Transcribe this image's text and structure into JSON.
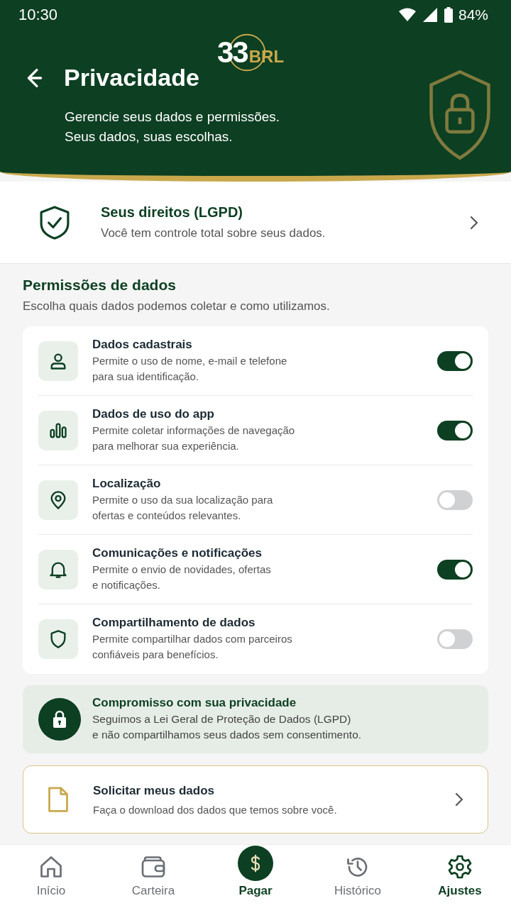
{
  "status_bar": {
    "time": "10:30",
    "battery": "84%"
  },
  "header": {
    "logo_number": "33",
    "logo_currency": "BRL",
    "title": "Privacidade",
    "subtitle": "Gerencie seus dados e permissões.\nSeus dados, suas escolhas."
  },
  "rights": {
    "title": "Seus direitos (LGPD)",
    "subtitle": "Você tem controle total sobre seus dados."
  },
  "permissions_section": {
    "title": "Permissões de dados",
    "subtitle": "Escolha quais dados podemos coletar e como utilizamos."
  },
  "permissions": [
    {
      "title": "Dados cadastrais",
      "description": "Permite o uso de nome, e-mail e telefone\npara sua identificação.",
      "on": true
    },
    {
      "title": "Dados de uso do app",
      "description": "Permite coletar informações de navegação\npara melhorar sua experiência.",
      "on": true
    },
    {
      "title": "Localização",
      "description": "Permite o uso da sua localização para\nofertas e conteúdos relevantes.",
      "on": false
    },
    {
      "title": "Comunicações e notificações",
      "description": "Permite o envio de novidades, ofertas\ne notificações.",
      "on": true
    },
    {
      "title": "Compartilhamento de dados",
      "description": "Permite compartilhar dados com parceiros\nconfiáveis para benefícios.",
      "on": false
    }
  ],
  "privacy_notice": {
    "title": "Compromisso com sua privacidade",
    "text": "Seguimos a Lei Geral de Proteção de Dados (LGPD)\ne não compartilhamos seus dados sem consentimento."
  },
  "data_request": {
    "title": "Solicitar meus dados",
    "subtitle": "Faça o download dos dados que temos sobre você."
  },
  "bottom_nav": [
    {
      "label": "Início",
      "kind": "tab",
      "selected": false
    },
    {
      "label": "Carteira",
      "kind": "tab",
      "selected": false
    },
    {
      "label": "Pagar",
      "kind": "action"
    },
    {
      "label": "Histórico",
      "kind": "tab",
      "selected": false
    },
    {
      "label": "Ajustes",
      "kind": "tab",
      "selected": true
    }
  ]
}
